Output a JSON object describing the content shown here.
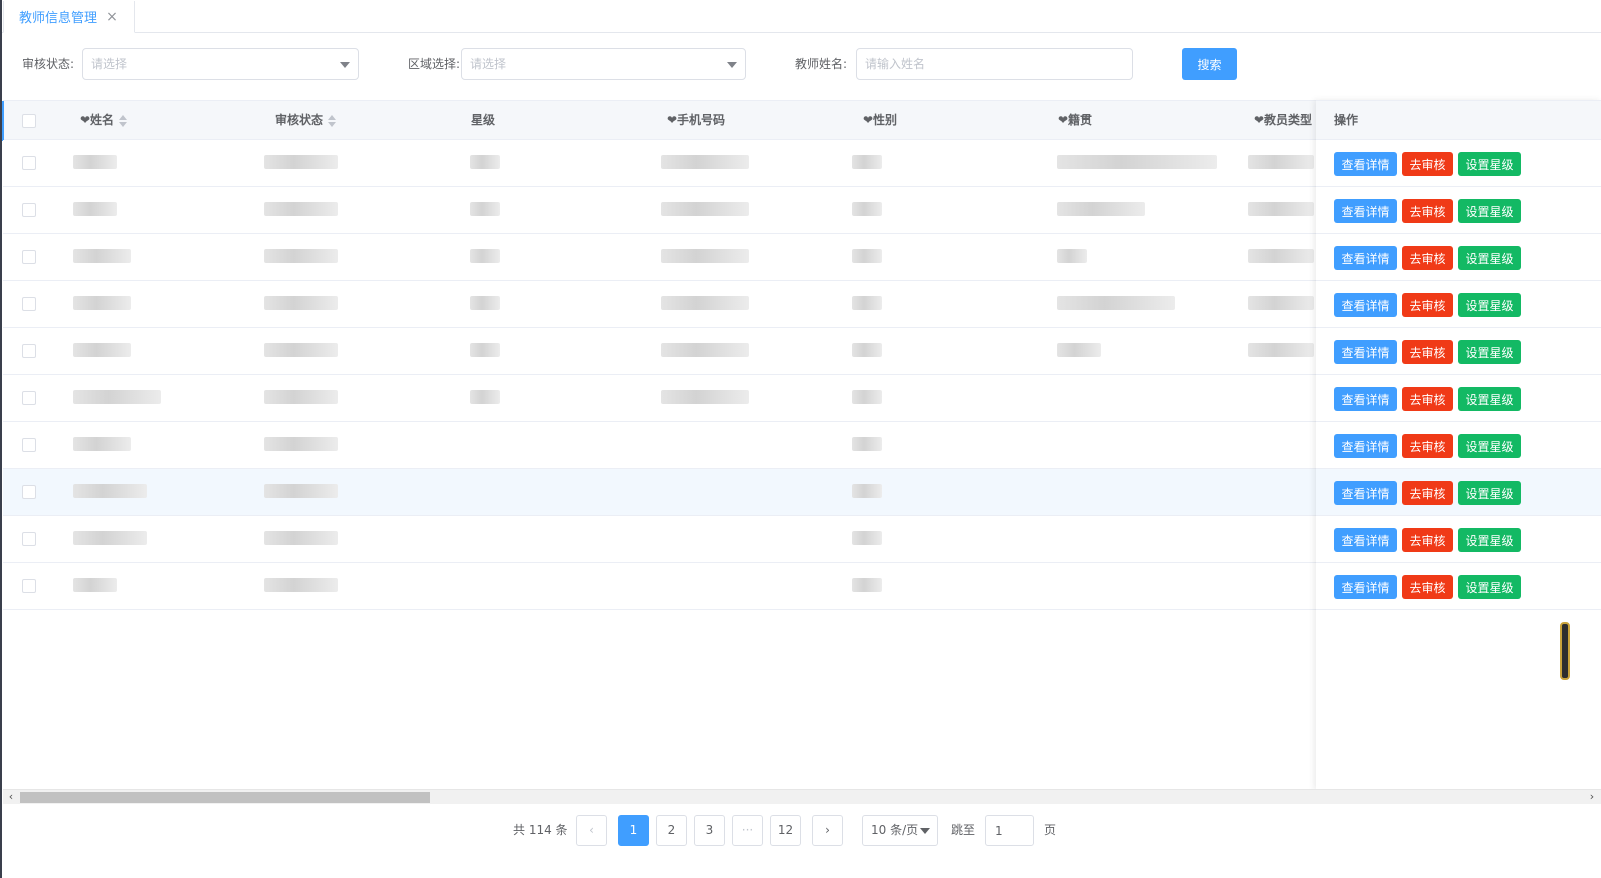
{
  "tabs": [
    {
      "label": "教师信息管理",
      "close": "×"
    }
  ],
  "filters": {
    "audit_status_label": "审核状态:",
    "audit_status_placeholder": "请选择",
    "region_label": "区域选择:",
    "region_placeholder": "请选择",
    "teacher_name_label": "教师姓名:",
    "teacher_name_placeholder": "请输入姓名",
    "search_button": "搜索"
  },
  "table": {
    "headers": {
      "name": "❤姓名",
      "audit_status": "审核状态",
      "star_level": "星级",
      "phone": "❤手机号码",
      "gender": "❤性别",
      "native_place": "❤籍贯",
      "teacher_type": "❤教员类型",
      "actions": "操作"
    },
    "action_labels": {
      "detail": "查看详情",
      "audit": "去审核",
      "set_star": "设置星级"
    },
    "row_count": 10,
    "highlighted_row": 8
  },
  "pagination": {
    "total": "共 114 条",
    "prev": "‹",
    "pages": [
      "1",
      "2",
      "3",
      "···",
      "12"
    ],
    "current": "1",
    "next": "›",
    "page_size": "10 条/页",
    "jump_label": "跳至",
    "jump_value": "1",
    "jump_suffix": "页"
  },
  "scrollbar": {
    "left_arrow": "‹",
    "right_arrow": "›"
  },
  "colors": {
    "primary": "#409eff",
    "danger": "#f03a17",
    "success": "#13b964"
  }
}
